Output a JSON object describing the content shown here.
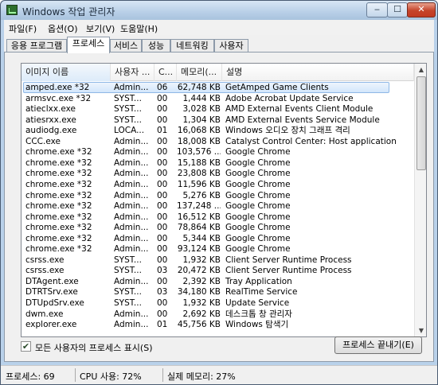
{
  "window": {
    "title": "Windows 작업 관리자",
    "min_label": "‒",
    "max_label": "☐",
    "close_label": "✕"
  },
  "menu": [
    {
      "label": "파일(F)"
    },
    {
      "label": "옵션(O)"
    },
    {
      "label": "보기(V)"
    },
    {
      "label": "도움말(H)"
    }
  ],
  "tabs": [
    {
      "label": "응용 프로그램",
      "active": false
    },
    {
      "label": "프로세스",
      "active": true
    },
    {
      "label": "서비스",
      "active": false
    },
    {
      "label": "성능",
      "active": false
    },
    {
      "label": "네트워킹",
      "active": false
    },
    {
      "label": "사용자",
      "active": false
    }
  ],
  "columns": {
    "image_name": "이미지 이름",
    "user": "사용자 ...",
    "cpu": "C...",
    "memory": "메모리(...",
    "description": "설명"
  },
  "processes": [
    {
      "name": "amped.exe *32",
      "user": "Admin...",
      "cpu": "06",
      "mem": "62,748 KB",
      "desc": "GetAmped Game Clients",
      "selected": true
    },
    {
      "name": "armsvc.exe *32",
      "user": "SYST...",
      "cpu": "00",
      "mem": "1,444 KB",
      "desc": "Adobe Acrobat Update Service"
    },
    {
      "name": "atieclxx.exe",
      "user": "SYST...",
      "cpu": "00",
      "mem": "3,028 KB",
      "desc": "AMD External Events Client Module"
    },
    {
      "name": "atiesrxx.exe",
      "user": "SYST...",
      "cpu": "00",
      "mem": "1,304 KB",
      "desc": "AMD External Events Service Module"
    },
    {
      "name": "audiodg.exe",
      "user": "LOCA...",
      "cpu": "01",
      "mem": "16,068 KB",
      "desc": "Windows 오디오 장치 그래프 격리"
    },
    {
      "name": "CCC.exe",
      "user": "Admin...",
      "cpu": "00",
      "mem": "18,008 KB",
      "desc": "Catalyst Control Center: Host application"
    },
    {
      "name": "chrome.exe *32",
      "user": "Admin...",
      "cpu": "00",
      "mem": "103,576 ...",
      "desc": "Google Chrome"
    },
    {
      "name": "chrome.exe *32",
      "user": "Admin...",
      "cpu": "00",
      "mem": "15,188 KB",
      "desc": "Google Chrome"
    },
    {
      "name": "chrome.exe *32",
      "user": "Admin...",
      "cpu": "00",
      "mem": "23,808 KB",
      "desc": "Google Chrome"
    },
    {
      "name": "chrome.exe *32",
      "user": "Admin...",
      "cpu": "00",
      "mem": "11,596 KB",
      "desc": "Google Chrome"
    },
    {
      "name": "chrome.exe *32",
      "user": "Admin...",
      "cpu": "00",
      "mem": "5,276 KB",
      "desc": "Google Chrome"
    },
    {
      "name": "chrome.exe *32",
      "user": "Admin...",
      "cpu": "00",
      "mem": "137,248 ...",
      "desc": "Google Chrome"
    },
    {
      "name": "chrome.exe *32",
      "user": "Admin...",
      "cpu": "00",
      "mem": "16,512 KB",
      "desc": "Google Chrome"
    },
    {
      "name": "chrome.exe *32",
      "user": "Admin...",
      "cpu": "00",
      "mem": "78,864 KB",
      "desc": "Google Chrome"
    },
    {
      "name": "chrome.exe *32",
      "user": "Admin...",
      "cpu": "00",
      "mem": "5,344 KB",
      "desc": "Google Chrome"
    },
    {
      "name": "chrome.exe *32",
      "user": "Admin...",
      "cpu": "00",
      "mem": "93,124 KB",
      "desc": "Google Chrome"
    },
    {
      "name": "csrss.exe",
      "user": "SYST...",
      "cpu": "00",
      "mem": "1,932 KB",
      "desc": "Client Server Runtime Process"
    },
    {
      "name": "csrss.exe",
      "user": "SYST...",
      "cpu": "03",
      "mem": "20,472 KB",
      "desc": "Client Server Runtime Process"
    },
    {
      "name": "DTAgent.exe",
      "user": "Admin...",
      "cpu": "00",
      "mem": "2,392 KB",
      "desc": "Tray Application"
    },
    {
      "name": "DTRTSrv.exe",
      "user": "SYST...",
      "cpu": "03",
      "mem": "34,180 KB",
      "desc": "RealTime Service"
    },
    {
      "name": "DTUpdSrv.exe",
      "user": "SYST...",
      "cpu": "00",
      "mem": "1,932 KB",
      "desc": "Update Service"
    },
    {
      "name": "dwm.exe",
      "user": "Admin...",
      "cpu": "00",
      "mem": "2,692 KB",
      "desc": "데스크톱 창 관리자"
    },
    {
      "name": "explorer.exe",
      "user": "Admin...",
      "cpu": "01",
      "mem": "45,756 KB",
      "desc": "Windows 탐색기"
    }
  ],
  "show_all_users": {
    "label": "모든 사용자의 프로세스 표시(S)",
    "checked": true,
    "mark": "✔"
  },
  "end_process_label": "프로세스 끝내기(E)",
  "status": {
    "processes": "프로세스: 69",
    "cpu": "CPU 사용: 72%",
    "memory": "실제 메모리: 27%"
  }
}
